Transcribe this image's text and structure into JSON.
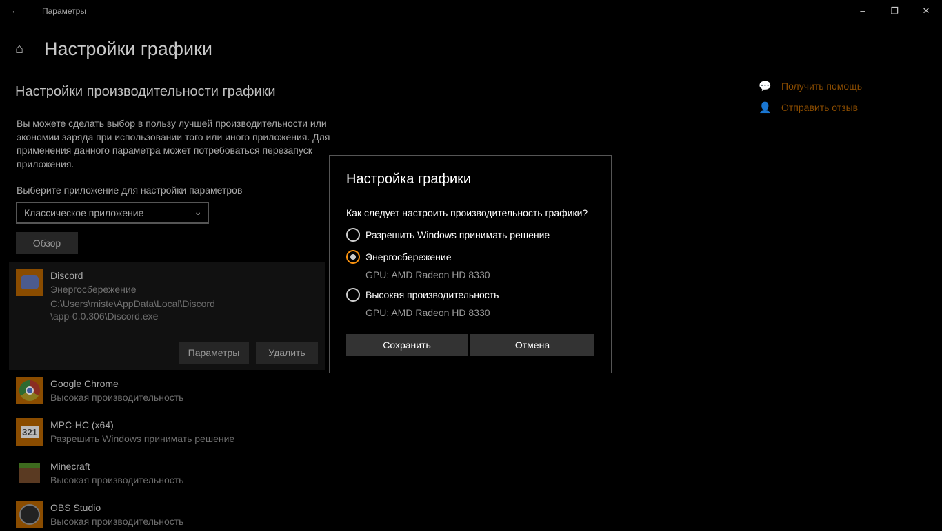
{
  "window": {
    "title": "Параметры",
    "back_icon": "arrow-left-icon"
  },
  "header": {
    "home_icon": "home-icon",
    "title": "Настройки графики"
  },
  "section": {
    "title": "Настройки производительности графики",
    "description": "Вы можете сделать выбор в пользу лучшей производительности или экономии заряда при использовании того или иного приложения. Для применения данного параметра может потребоваться перезапуск приложения.",
    "select_label": "Выберите приложение для настройки параметров",
    "select_value": "Классическое приложение",
    "browse_label": "Обзор"
  },
  "apps": [
    {
      "name": "Discord",
      "mode": "Энергосбережение",
      "path1": "C:\\Users\\miste\\AppData\\Local\\Discord",
      "path2": "\\app-0.0.306\\Discord.exe",
      "options_label": "Параметры",
      "remove_label": "Удалить"
    },
    {
      "name": "Google Chrome",
      "mode": "Высокая производительность"
    },
    {
      "name": "MPC-HC (x64)",
      "mode": "Разрешить Windows принимать решение"
    },
    {
      "name": "Minecraft",
      "mode": "Высокая производительность"
    },
    {
      "name": "OBS Studio",
      "mode": "Высокая производительность"
    }
  ],
  "help": {
    "get_help": "Получить помощь",
    "feedback": "Отправить отзыв",
    "link_color": "#8a4c00"
  },
  "dialog": {
    "title": "Настройка графики",
    "question": "Как следует настроить производительность графики?",
    "options": [
      {
        "label": "Разрешить Windows принимать решение",
        "selected": false
      },
      {
        "label": "Энергосбережение",
        "gpu": "GPU: AMD Radeon HD 8330",
        "selected": true
      },
      {
        "label": "Высокая производительность",
        "gpu": "GPU: AMD Radeon HD 8330",
        "selected": false
      }
    ],
    "save_label": "Сохранить",
    "cancel_label": "Отмена",
    "accent": "#f7900f"
  }
}
